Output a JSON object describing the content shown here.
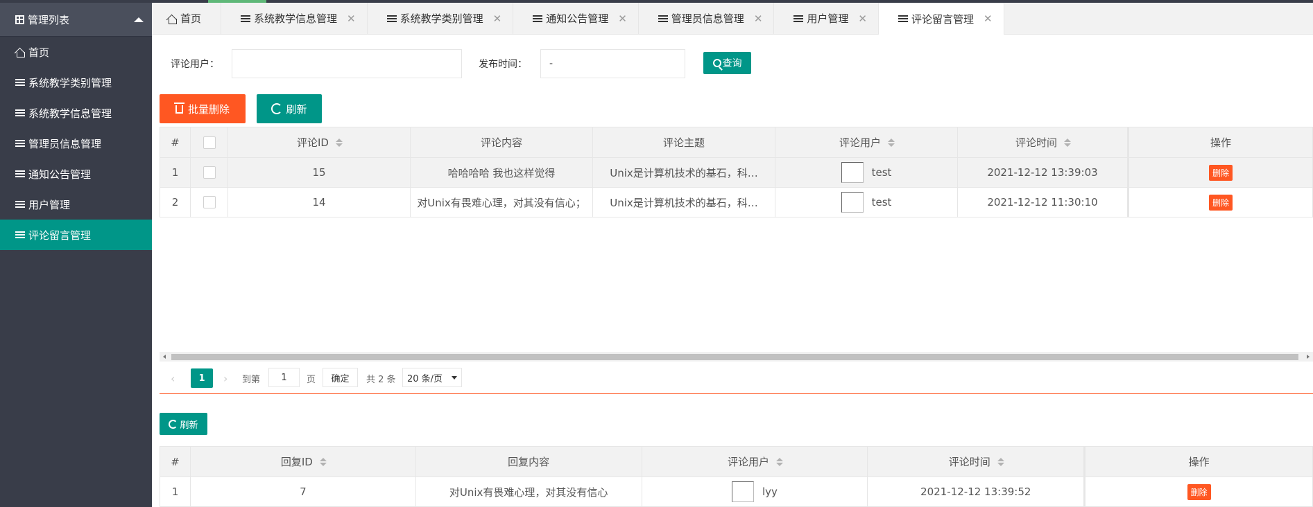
{
  "sidebar": {
    "header": "管理列表",
    "items": [
      {
        "label": "首页"
      },
      {
        "label": "系统教学类别管理"
      },
      {
        "label": "系统教学信息管理"
      },
      {
        "label": "管理员信息管理"
      },
      {
        "label": "通知公告管理"
      },
      {
        "label": "用户管理"
      },
      {
        "label": "评论留言管理"
      }
    ]
  },
  "tabs": [
    {
      "label": "首页"
    },
    {
      "label": "系统教学信息管理"
    },
    {
      "label": "系统教学类别管理"
    },
    {
      "label": "通知公告管理"
    },
    {
      "label": "管理员信息管理"
    },
    {
      "label": "用户管理"
    },
    {
      "label": "评论留言管理"
    }
  ],
  "search": {
    "user_label": "评论用户：",
    "user_value": "",
    "time_label": "发布时间：",
    "time_value": "-",
    "query_label": "查询"
  },
  "toolbar": {
    "batch_delete": "批量删除",
    "refresh": "刷新"
  },
  "comments_table": {
    "headers": {
      "index": "#",
      "id": "评论ID",
      "content": "评论内容",
      "topic": "评论主题",
      "user": "评论用户",
      "time": "评论时间",
      "action": "操作"
    },
    "rows": [
      {
        "index": "1",
        "id": "15",
        "content": "哈哈哈哈  我也这样觉得",
        "topic": "Unix是计算机技术的基石，科…",
        "user": "test",
        "time": "2021-12-12 13:39:03",
        "action": "删除"
      },
      {
        "index": "2",
        "id": "14",
        "content": "对Unix有畏难心理，对其没有信心；",
        "topic": "Unix是计算机技术的基石，科…",
        "user": "test",
        "time": "2021-12-12 11:30:10",
        "action": "删除"
      }
    ]
  },
  "pager": {
    "current": "1",
    "goto": "到第",
    "page_input": "1",
    "page_unit": "页",
    "confirm": "确定",
    "total": "共 2 条",
    "page_size": "20 条/页"
  },
  "reply_toolbar": {
    "refresh": "刷新"
  },
  "replies_table": {
    "headers": {
      "index": "#",
      "id": "回复ID",
      "content": "回复内容",
      "user": "评论用户",
      "time": "评论时间",
      "action": "操作"
    },
    "rows": [
      {
        "index": "1",
        "id": "7",
        "content": "对Unix有畏难心理，对其没有信心",
        "user": "lyy",
        "time": "2021-12-12 13:39:52",
        "action": "删除"
      }
    ]
  },
  "colors": {
    "sidebar_bg": "#393d49",
    "primary": "#009688",
    "danger": "#ff5722"
  }
}
